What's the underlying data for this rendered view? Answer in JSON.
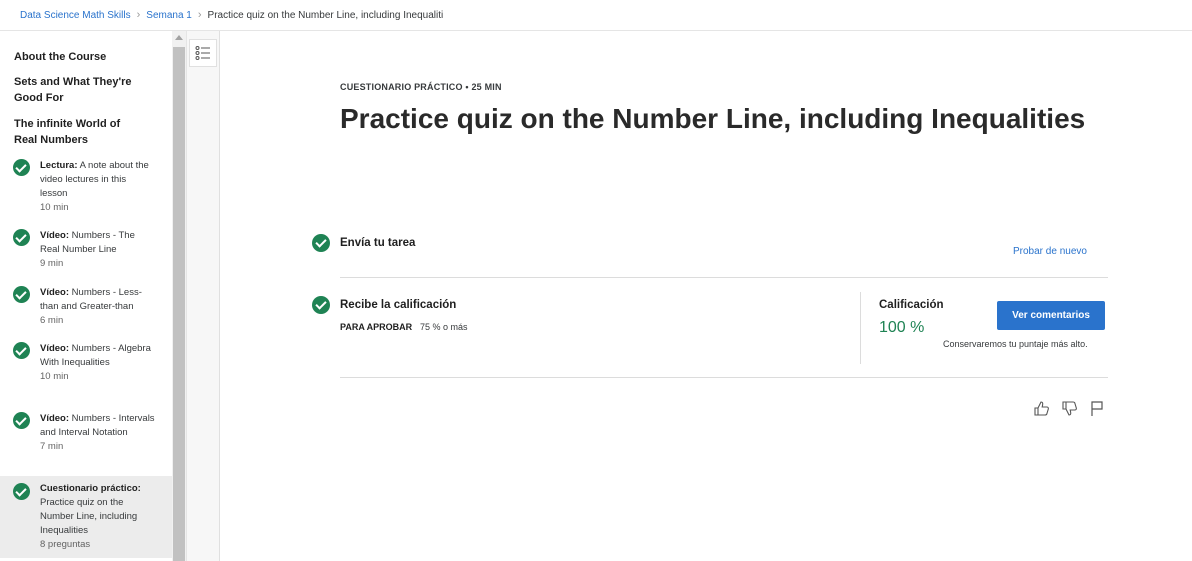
{
  "breadcrumb": {
    "course": "Data Science Math Skills",
    "week": "Semana 1",
    "current": "Practice quiz on the Number Line, including Inequaliti"
  },
  "sidebar": {
    "sections": [
      "About the Course",
      "Sets and What They're Good For",
      "The infinite World of Real Numbers"
    ],
    "items": [
      {
        "kind": "Lectura:",
        "title": "A note about the video lectures in this lesson",
        "meta": "10 min",
        "completed": true
      },
      {
        "kind": "Vídeo:",
        "title": "Numbers - The Real Number Line",
        "meta": "9 min",
        "completed": true
      },
      {
        "kind": "Vídeo:",
        "title": "Numbers - Less-than and Greater-than",
        "meta": "6 min",
        "completed": true
      },
      {
        "kind": "Vídeo:",
        "title": "Numbers - Algebra With Inequalities",
        "meta": "10 min",
        "completed": true
      },
      {
        "kind": "Vídeo:",
        "title": "Numbers - Intervals and Interval Notation",
        "meta": "7 min",
        "completed": true
      },
      {
        "kind": "Cuestionario práctico:",
        "title": "Practice quiz on the Number Line, including Inequalities",
        "meta": "8 preguntas",
        "completed": true,
        "active": true
      }
    ]
  },
  "main": {
    "eyebrow": "CUESTIONARIO PRÁCTICO • 25 MIN",
    "title": "Practice quiz on the Number Line, including Inequalities",
    "submit": {
      "title": "Envía tu tarea",
      "retry_label": "Probar de nuevo"
    },
    "grade": {
      "title": "Recibe la calificación",
      "pass_label": "PARA APROBAR",
      "pass_value": "75 % o más",
      "grade_label": "Calificación",
      "grade_value": "100 %",
      "feedback_button": "Ver comentarios",
      "note": "Conservaremos tu puntaje más alto."
    }
  },
  "colors": {
    "accent": "#2a73cc",
    "success": "#1f8354"
  },
  "icons": [
    "menu-list-icon",
    "check-icon",
    "thumbs-up-icon",
    "thumbs-down-icon",
    "flag-icon"
  ]
}
